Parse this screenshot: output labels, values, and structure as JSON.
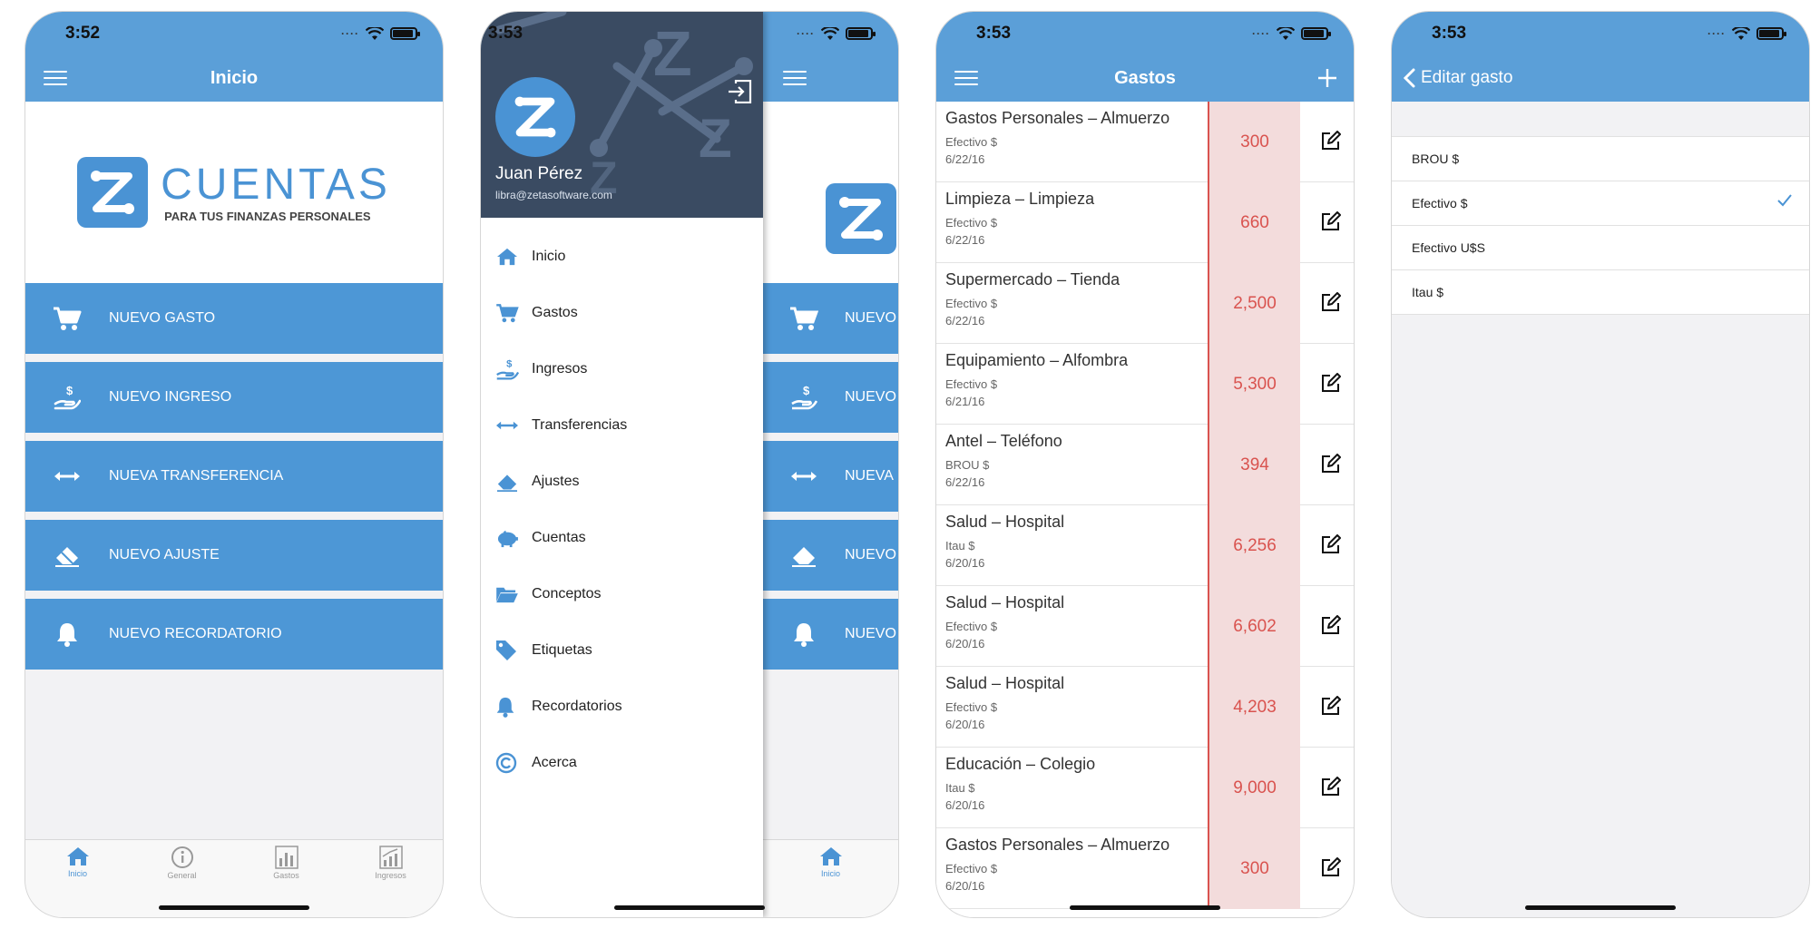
{
  "screen1": {
    "status_time": "3:52",
    "nav_title": "Inicio",
    "logo": {
      "brand": "CUENTAS",
      "tagline": "PARA TUS FINANZAS PERSONALES"
    },
    "actions": [
      {
        "label": "NUEVO GASTO",
        "icon": "cart-icon"
      },
      {
        "label": "NUEVO INGRESO",
        "icon": "money-hand-icon"
      },
      {
        "label": "NUEVA TRANSFERENCIA",
        "icon": "transfer-arrows-icon"
      },
      {
        "label": "NUEVO AJUSTE",
        "icon": "eraser-icon"
      },
      {
        "label": "NUEVO RECORDATORIO",
        "icon": "bell-icon"
      }
    ],
    "tabs": [
      {
        "label": "Inicio",
        "icon": "home-icon",
        "active": true
      },
      {
        "label": "General",
        "icon": "info-icon",
        "active": false
      },
      {
        "label": "Gastos",
        "icon": "bar-chart-icon",
        "active": false
      },
      {
        "label": "Ingresos",
        "icon": "line-chart-icon",
        "active": false
      }
    ]
  },
  "screen2": {
    "status_time": "3:53",
    "user_name": "Juan Pérez",
    "user_email": "libra@zetasoftware.com",
    "menu": [
      {
        "label": "Inicio",
        "icon": "home-icon"
      },
      {
        "label": "Gastos",
        "icon": "cart-icon"
      },
      {
        "label": "Ingresos",
        "icon": "money-hand-icon"
      },
      {
        "label": "Transferencias",
        "icon": "transfer-arrows-icon"
      },
      {
        "label": "Ajustes",
        "icon": "eraser-icon"
      },
      {
        "label": "Cuentas",
        "icon": "piggy-bank-icon"
      },
      {
        "label": "Conceptos",
        "icon": "folder-open-icon"
      },
      {
        "label": "Etiquetas",
        "icon": "tag-icon"
      },
      {
        "label": "Recordatorios",
        "icon": "bell-icon"
      },
      {
        "label": "Acerca",
        "icon": "copyright-icon"
      }
    ],
    "behind_actions": [
      "NUEVO",
      "NUEVO",
      "NUEVA",
      "NUEVO",
      "NUEVO"
    ],
    "behind_tab": "Inicio"
  },
  "screen3": {
    "status_time": "3:53",
    "nav_title": "Gastos",
    "expenses": [
      {
        "title": "Gastos Personales – Almuerzo",
        "account": "Efectivo $",
        "date": "6/22/16",
        "amount": "300"
      },
      {
        "title": "Limpieza – Limpieza",
        "account": "Efectivo $",
        "date": "6/22/16",
        "amount": "660"
      },
      {
        "title": "Supermercado – Tienda",
        "account": "Efectivo $",
        "date": "6/22/16",
        "amount": "2,500"
      },
      {
        "title": "Equipamiento – Alfombra",
        "account": "Efectivo $",
        "date": "6/21/16",
        "amount": "5,300"
      },
      {
        "title": "Antel – Teléfono",
        "account": "BROU $",
        "date": "6/22/16",
        "amount": "394"
      },
      {
        "title": "Salud – Hospital",
        "account": "Itau $",
        "date": "6/20/16",
        "amount": "6,256"
      },
      {
        "title": "Salud – Hospital",
        "account": "Efectivo $",
        "date": "6/20/16",
        "amount": "6,602"
      },
      {
        "title": "Salud – Hospital",
        "account": "Efectivo $",
        "date": "6/20/16",
        "amount": "4,203"
      },
      {
        "title": "Educación – Colegio",
        "account": "Itau $",
        "date": "6/20/16",
        "amount": "9,000"
      },
      {
        "title": "Gastos Personales – Almuerzo",
        "account": "Efectivo $",
        "date": "6/20/16",
        "amount": "300"
      }
    ]
  },
  "screen4": {
    "status_time": "3:53",
    "back_label": "Editar gasto",
    "options": [
      {
        "label": "BROU $",
        "selected": false
      },
      {
        "label": "Efectivo $",
        "selected": true
      },
      {
        "label": "Efectivo U$S",
        "selected": false
      },
      {
        "label": "Itau $",
        "selected": false
      }
    ]
  },
  "colors": {
    "primary": "#5b9fd8",
    "button": "#4d97d6",
    "amount": "#d9534f",
    "amount_bg": "#f3dcdc",
    "drawer_header": "#3a4b62"
  }
}
